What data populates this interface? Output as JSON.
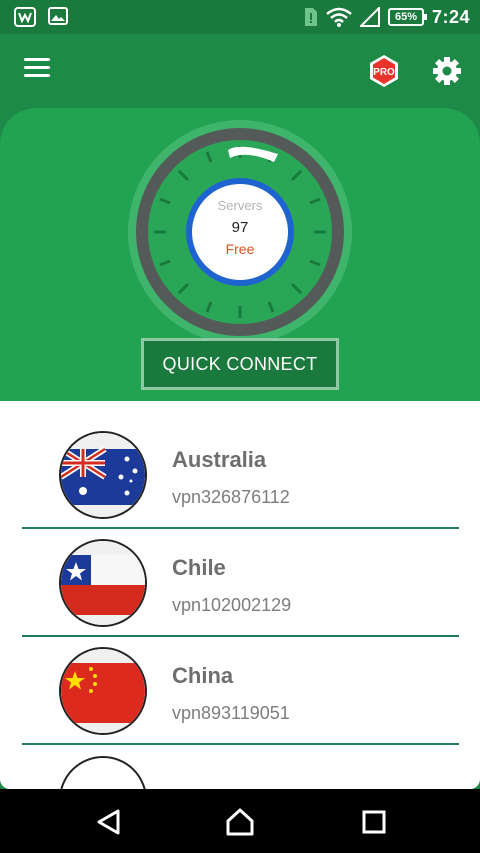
{
  "status_bar": {
    "battery": "65%",
    "time": "7:24"
  },
  "icons": {
    "menu": "hamburger-menu-icon",
    "pro": "pro-badge-icon",
    "settings": "gear-icon",
    "nav_back": "triangle-back-icon",
    "nav_home": "home-icon",
    "nav_recents": "square-recents-icon"
  },
  "app_bar": {
    "pro_label": "PRO"
  },
  "dial": {
    "label": "Servers",
    "count": "97",
    "tier": "Free"
  },
  "quick_connect": {
    "label": "QUICK CONNECT"
  },
  "servers": [
    {
      "country": "Australia",
      "host": "vpn326876112",
      "flag": "australia-flag"
    },
    {
      "country": "Chile",
      "host": "vpn102002129",
      "flag": "chile-flag"
    },
    {
      "country": "China",
      "host": "vpn893119051",
      "flag": "china-flag"
    }
  ],
  "colors": {
    "primary": "#1e8a47",
    "hero": "#21a351",
    "accent_blue": "#1f63d1",
    "free_orange": "#d6531e"
  }
}
